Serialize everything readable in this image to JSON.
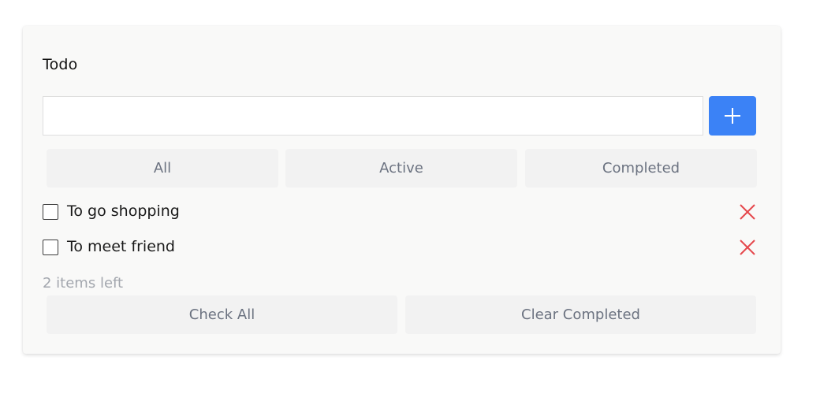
{
  "app": {
    "title": "Todo"
  },
  "input": {
    "value": "",
    "placeholder": ""
  },
  "add_button": {
    "icon": "plus-icon",
    "color": "#3b82f6"
  },
  "filters": [
    {
      "label": "All"
    },
    {
      "label": "Active"
    },
    {
      "label": "Completed"
    }
  ],
  "todos": [
    {
      "text": "To go shopping",
      "completed": false,
      "delete_icon": "close-icon"
    },
    {
      "text": "To meet friend",
      "completed": false,
      "delete_icon": "close-icon"
    }
  ],
  "footer": {
    "items_left": "2 items left",
    "check_all_label": "Check All",
    "clear_completed_label": "Clear Completed"
  },
  "colors": {
    "accent": "#3b82f6",
    "delete": "#e5484d",
    "muted_text": "#a3a7ae",
    "button_text": "#6b7280"
  }
}
